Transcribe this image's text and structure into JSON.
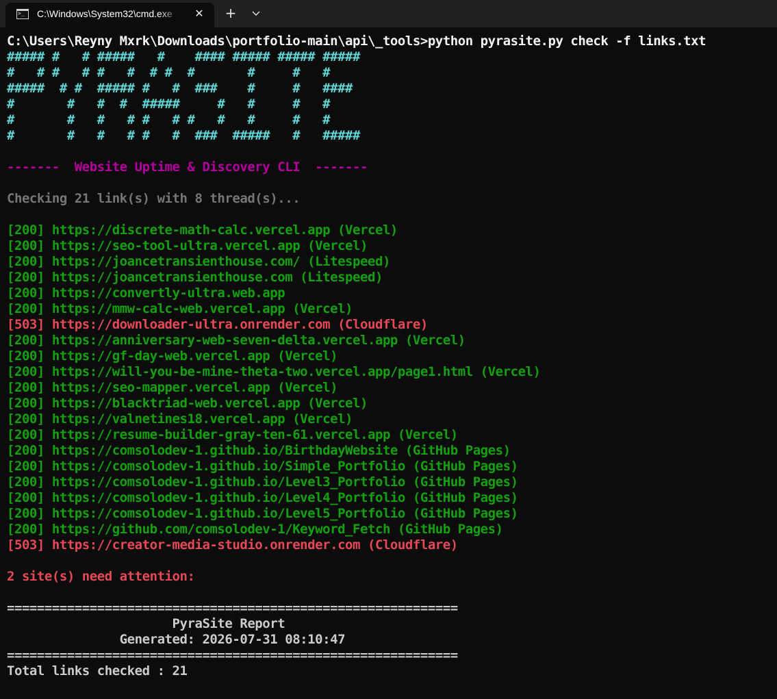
{
  "window": {
    "tab_title": "C:\\Windows\\System32\\cmd.exe",
    "close_glyph": "✕",
    "new_tab_glyph": "+"
  },
  "terminal": {
    "prompt": "C:\\Users\\Reyny Mxrk\\Downloads\\portfolio-main\\api\\_tools>python pyrasite.py check -f links.txt",
    "ascii_art": [
      "##### #   # #####   #    #### ##### ##### #####",
      "#   # #   # #   #  # #  #       #     #   #",
      "#####  # #  ##### #   #  ###    #     #   ####",
      "#       #   #  #  #####     #   #     #   #",
      "#       #   #   # #   # #   #   #     #   #",
      "#       #   #   # #   #  ###  #####   #   #####"
    ],
    "banner": "-------  Website Uptime & Discovery CLI  -------",
    "checking": "Checking 21 link(s) with 8 thread(s)...",
    "results": [
      {
        "text": "[200] https://discrete-math-calc.vercel.app (Vercel)",
        "status": "ok"
      },
      {
        "text": "[200] https://seo-tool-ultra.vercel.app (Vercel)",
        "status": "ok"
      },
      {
        "text": "[200] https://joancetransienthouse.com/ (Litespeed)",
        "status": "ok"
      },
      {
        "text": "[200] https://joancetransienthouse.com (Litespeed)",
        "status": "ok"
      },
      {
        "text": "[200] https://convertly-ultra.web.app",
        "status": "ok"
      },
      {
        "text": "[200] https://mmw-calc-web.vercel.app (Vercel)",
        "status": "ok"
      },
      {
        "text": "[503] https://downloader-ultra.onrender.com (Cloudflare)",
        "status": "err"
      },
      {
        "text": "[200] https://anniversary-web-seven-delta.vercel.app (Vercel)",
        "status": "ok"
      },
      {
        "text": "[200] https://gf-day-web.vercel.app (Vercel)",
        "status": "ok"
      },
      {
        "text": "[200] https://will-you-be-mine-theta-two.vercel.app/page1.html (Vercel)",
        "status": "ok"
      },
      {
        "text": "[200] https://seo-mapper.vercel.app (Vercel)",
        "status": "ok"
      },
      {
        "text": "[200] https://blacktriad-web.vercel.app (Vercel)",
        "status": "ok"
      },
      {
        "text": "[200] https://valnetines18.vercel.app (Vercel)",
        "status": "ok"
      },
      {
        "text": "[200] https://resume-builder-gray-ten-61.vercel.app (Vercel)",
        "status": "ok"
      },
      {
        "text": "[200] https://comsolodev-1.github.io/BirthdayWebsite (GitHub Pages)",
        "status": "ok"
      },
      {
        "text": "[200] https://comsolodev-1.github.io/Simple_Portfolio (GitHub Pages)",
        "status": "ok"
      },
      {
        "text": "[200] https://comsolodev-1.github.io/Level3_Portfolio (GitHub Pages)",
        "status": "ok"
      },
      {
        "text": "[200] https://comsolodev-1.github.io/Level4_Portfolio (GitHub Pages)",
        "status": "ok"
      },
      {
        "text": "[200] https://comsolodev-1.github.io/Level5_Portfolio (GitHub Pages)",
        "status": "ok"
      },
      {
        "text": "[200] https://github.com/comsolodev-1/Keyword_Fetch (GitHub Pages)",
        "status": "ok"
      },
      {
        "text": "[503] https://creator-media-studio.onrender.com (Cloudflare)",
        "status": "err"
      }
    ],
    "attention": "2 site(s) need attention:",
    "report": {
      "separator": "============================================================",
      "title": "                      PyraSite Report",
      "generated": "               Generated: 2026-07-31 08:10:47",
      "total": "Total links checked : 21"
    }
  },
  "colors": {
    "background": "#0c0c0c",
    "titlebar": "#202020",
    "ascii": "#61d6d6",
    "banner": "#b4009e",
    "info": "#767676",
    "ok": "#13a10e",
    "error": "#e74856",
    "text": "#cccccc"
  }
}
